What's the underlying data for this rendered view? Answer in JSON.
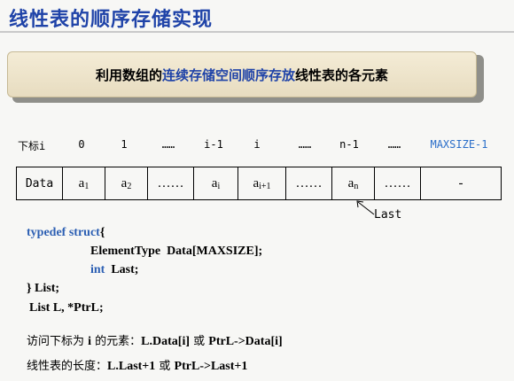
{
  "title": "线性表的顺序存储实现",
  "banner": {
    "prefix": "利用数组的",
    "highlight": "连续存储空间顺序存放",
    "suffix": "线性表的各元素"
  },
  "index_row": {
    "label": "下标i",
    "items": [
      "0",
      "1",
      "……",
      "i-1",
      "i",
      "……",
      "n-1",
      "……",
      "MAXSIZE-1"
    ]
  },
  "array": {
    "label": "Data",
    "cells": [
      {
        "base": "a",
        "sub": "1"
      },
      {
        "base": "a",
        "sub": "2"
      },
      {
        "base": "……",
        "sub": ""
      },
      {
        "base": "a",
        "sub": "i"
      },
      {
        "base": "a",
        "sub": "i+1"
      },
      {
        "base": "……",
        "sub": ""
      },
      {
        "base": "a",
        "sub": "n"
      },
      {
        "base": "……",
        "sub": ""
      },
      {
        "base": "-",
        "sub": ""
      }
    ]
  },
  "pointer_label": "Last",
  "code": {
    "typedef_kw": "typedef",
    "struct_kw": "struct",
    "brace_open": "{",
    "line2": "ElementType  Data[MAXSIZE];",
    "int_kw": "int",
    "line3_rest": "  Last;",
    "line4": "} List;"
  },
  "declaration": "List L, *PtrL;",
  "access_note": {
    "prefix": "访问下标为 ",
    "var": "i",
    "middle": " 的元素：",
    "expr1": "L.Data[i]",
    "or": " 或 ",
    "expr2": "PtrL->Data[i]"
  },
  "length_note": {
    "prefix": "线性表的长度：",
    "expr1": "L.Last+1",
    "or": " 或 ",
    "expr2": "PtrL->Last+1"
  },
  "colors": {
    "title": "#1f43a8",
    "keyword": "#2c5fb3",
    "index_blue": "#2a6ec9"
  }
}
